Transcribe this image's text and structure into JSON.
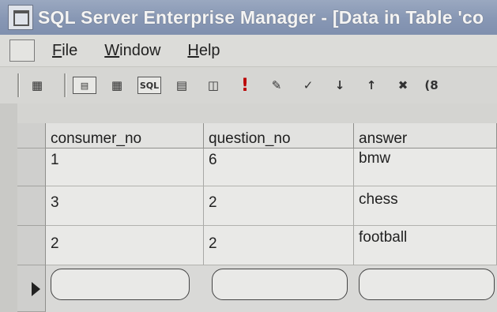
{
  "window": {
    "title": "SQL Server Enterprise Manager - [Data in Table 'co"
  },
  "menu": {
    "items": [
      {
        "pre": "",
        "ul": "F",
        "post": "ile"
      },
      {
        "pre": "",
        "ul": "W",
        "post": "indow"
      },
      {
        "pre": "",
        "ul": "H",
        "post": "elp"
      }
    ]
  },
  "toolbar": {
    "buttons": [
      "properties-icon",
      "show-diagram-icon",
      "show-grid-icon",
      "sql-icon",
      "show-results-icon",
      "change-query-type-icon",
      "run-icon",
      "verify-sql-icon",
      "sort-asc-icon",
      "sort-desc-icon",
      "remove-filter-icon"
    ],
    "sql_label": "SQL",
    "run_label": "!",
    "extra_glyph": "(8"
  },
  "table": {
    "columns": [
      "consumer_no",
      "question_no",
      "answer"
    ],
    "rows": [
      [
        "1",
        "6",
        "bmw"
      ],
      [
        "3",
        "2",
        "chess"
      ],
      [
        "2",
        "2",
        "football"
      ]
    ]
  }
}
